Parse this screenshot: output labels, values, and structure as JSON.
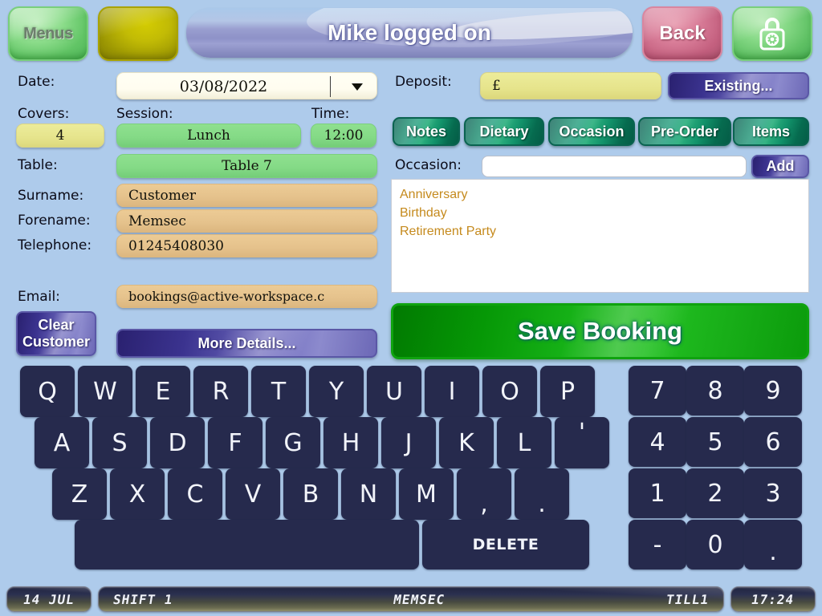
{
  "topbar": {
    "menus_label": "Menus",
    "blank_label": "",
    "title": "Mike logged on",
    "back_label": "Back",
    "lock_icon": "padlock-icon"
  },
  "form": {
    "date_label": "Date:",
    "date_value": "03/08/2022",
    "date_dropdown_icon": "chevron-down-icon",
    "covers_label": "Covers:",
    "covers_value": "4",
    "session_label": "Session:",
    "session_value": "Lunch",
    "time_label": "Time:",
    "time_value": "12:00",
    "table_label": "Table:",
    "table_value": "Table 7",
    "surname_label": "Surname:",
    "surname_value": "Customer",
    "forename_label": "Forename:",
    "forename_value": "Memsec",
    "telephone_label": "Telephone:",
    "telephone_value": "01245408030",
    "email_label": "Email:",
    "email_value": "bookings@active-workspace.c",
    "clear_customer_label": "Clear\nCustomer",
    "clear_customer_line1": "Clear",
    "clear_customer_line2": "Customer",
    "more_details_label": "More Details..."
  },
  "right": {
    "deposit_label": "Deposit:",
    "deposit_value": "£",
    "existing_label": "Existing...",
    "tabs": [
      {
        "label": "Notes",
        "active": false
      },
      {
        "label": "Dietary",
        "active": false
      },
      {
        "label": "Occasion",
        "active": true
      },
      {
        "label": "Pre-Order",
        "active": false
      },
      {
        "label": "Items",
        "active": false
      }
    ],
    "occasion_label": "Occasion:",
    "occasion_input_value": "",
    "add_label": "Add",
    "occasion_items": [
      "Anniversary",
      "Birthday",
      "Retirement Party"
    ],
    "save_booking_label": "Save Booking"
  },
  "keyboard": {
    "row1": [
      "Q",
      "W",
      "E",
      "R",
      "T",
      "Y",
      "U",
      "I",
      "O",
      "P"
    ],
    "row2": [
      "A",
      "S",
      "D",
      "F",
      "G",
      "H",
      "J",
      "K",
      "L",
      "'"
    ],
    "row3": [
      "Z",
      "X",
      "C",
      "V",
      "B",
      "N",
      "M",
      ",",
      "."
    ],
    "space_label": "",
    "delete_label": "DELETE"
  },
  "keypad": {
    "rows": [
      [
        "7",
        "8",
        "9"
      ],
      [
        "4",
        "5",
        "6"
      ],
      [
        "1",
        "2",
        "3"
      ],
      [
        "-",
        "0",
        "."
      ]
    ]
  },
  "statusbar": {
    "date": "14 JUL",
    "shift": "SHIFT 1",
    "user": "MEMSEC",
    "till": "TILL1",
    "time": "17:24"
  },
  "colors": {
    "background": "#aecbeb",
    "key": "#262a4d",
    "accent_green": "#74cd78",
    "accent_purple": "#3b338f",
    "accent_teal": "#0e7f63",
    "save_green": "#17b318",
    "occasion_text": "#c58a1d"
  }
}
